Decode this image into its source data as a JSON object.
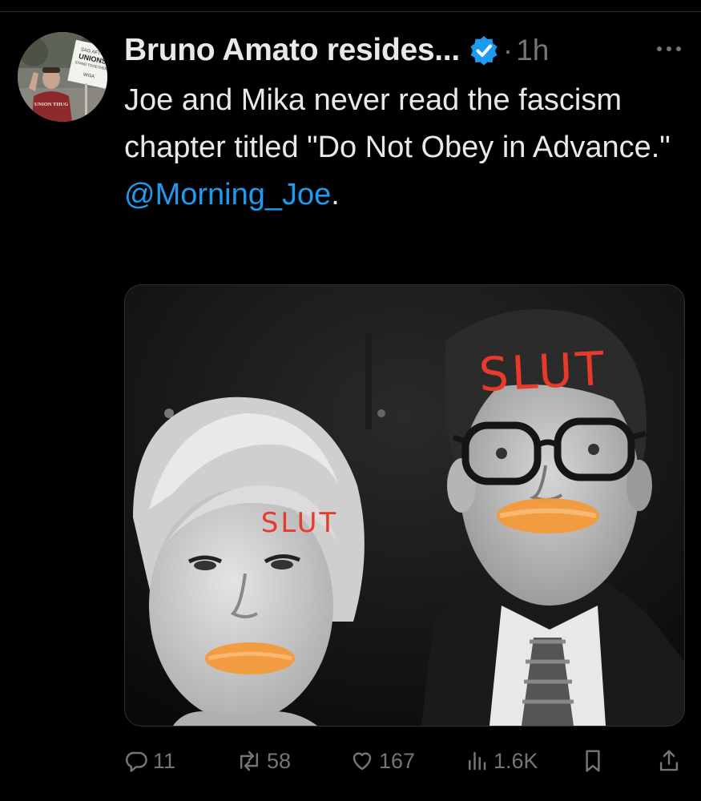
{
  "tweet": {
    "author_name": "Bruno Amato resides...",
    "separator": "·",
    "time": "1h",
    "text_line": "Joe and Mika never read the fascism chapter titled \"Do Not Obey in Advance.\"",
    "mention": "@Morning_Joe",
    "mention_suffix": "."
  },
  "avatar": {
    "sign_main": "UNIONS",
    "sign_sub": "STAND TOGETHER",
    "sign_top": "SAG AFTRA",
    "sign_bottom": "WGA",
    "shirt_text": "UNION THUG"
  },
  "media": {
    "label_left": "SLUT",
    "label_right": "SLUT"
  },
  "actions": {
    "replies": "11",
    "reposts": "58",
    "likes": "167",
    "views": "1.6K"
  },
  "colors": {
    "background": "#000000",
    "text": "#e7e9ea",
    "muted": "#71767b",
    "link": "#1d9bf0",
    "verified": "#1d9bf0",
    "scrawl_red": "#e83a2a",
    "scrawl_orange": "#f49a3a"
  },
  "icons": [
    "verified-badge-icon",
    "more-icon",
    "reply-icon",
    "repost-icon",
    "like-icon",
    "views-icon",
    "bookmark-icon",
    "share-icon"
  ]
}
